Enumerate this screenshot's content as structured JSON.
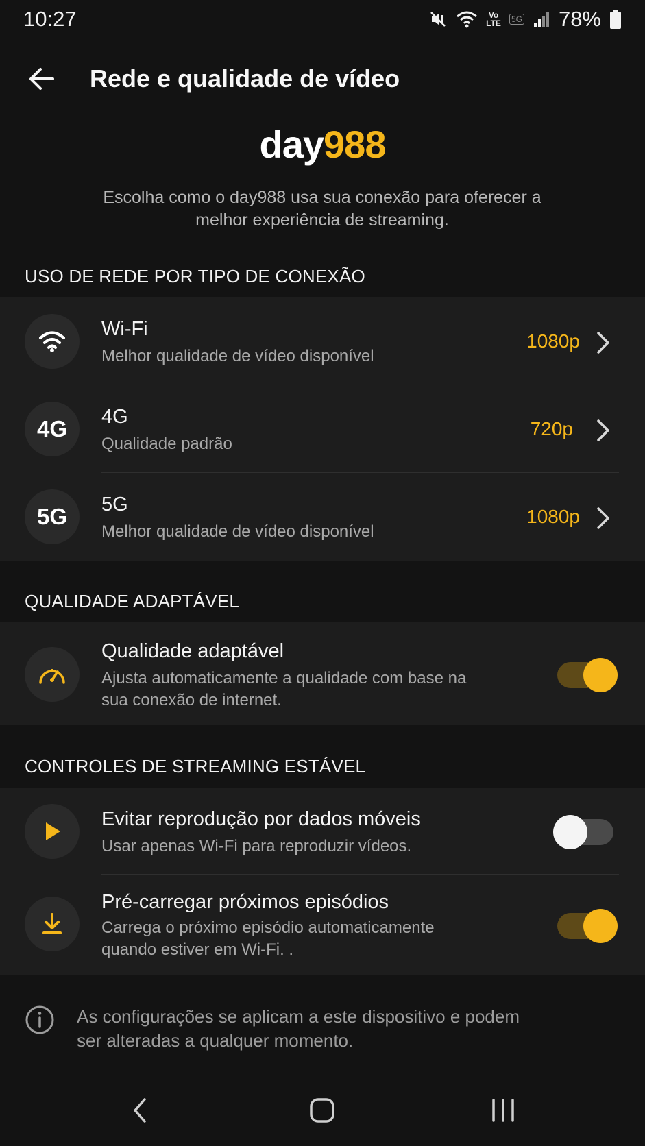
{
  "status_bar": {
    "time": "10:27",
    "volte_top": "Vo",
    "volte_bottom": "LTE",
    "net_5g": "5G",
    "battery": "78%"
  },
  "header": {
    "title": "Rede e qualidade de vídeo",
    "back_icon": "arrow-left-icon"
  },
  "brand": {
    "part_a": "day",
    "part_b": "988",
    "accent_color": "#f5b61a"
  },
  "intro": "Escolha como o day988 usa sua conexão para oferecer a melhor experiência de streaming.",
  "network_section": {
    "header": "USO DE REDE POR TIPO DE CONEXÃO",
    "rows": [
      {
        "icon": "wifi-icon",
        "title": "Wi-Fi",
        "subtitle": "Melhor qualidade de vídeo disponível",
        "value": "1080p"
      },
      {
        "icon_text": "4G",
        "title": "4G",
        "subtitle": "Qualidade padrão",
        "value": "720p"
      },
      {
        "icon_text": "5G",
        "title": "5G",
        "subtitle": "Melhor qualidade de vídeo disponível",
        "value": "1080p"
      }
    ]
  },
  "adaptive_section": {
    "header": "QUALIDADE ADAPTÁVEL",
    "row": {
      "icon": "speedometer-icon",
      "title": "Qualidade adaptável",
      "subtitle_line1": "Ajusta automaticamente a qualidade com base na",
      "subtitle_line2": "sua conexão de internet.",
      "enabled": true
    }
  },
  "streaming_section": {
    "header": "CONTROLES DE STREAMING ESTÁVEL",
    "rows": [
      {
        "icon": "play-icon",
        "title": "Evitar reprodução por dados móveis",
        "subtitle_line1": "Usar apenas Wi-Fi para reproduzir vídeos.",
        "subtitle_line2": "",
        "enabled": false
      },
      {
        "icon": "download-icon",
        "title": "Pré-carregar próximos episódios",
        "subtitle_line1": "Carrega o próximo episódio automaticamente",
        "subtitle_line2": "quando estiver em Wi-Fi. .",
        "enabled": true
      }
    ]
  },
  "footer_info": {
    "icon": "info-icon",
    "text_line1": "As configurações se aplicam a este dispositivo e podem",
    "text_line2": "ser alteradas a qualquer momento."
  },
  "nav_bar": {
    "back": "nav-back-icon",
    "home": "nav-home-icon",
    "recents": "nav-recents-icon"
  }
}
